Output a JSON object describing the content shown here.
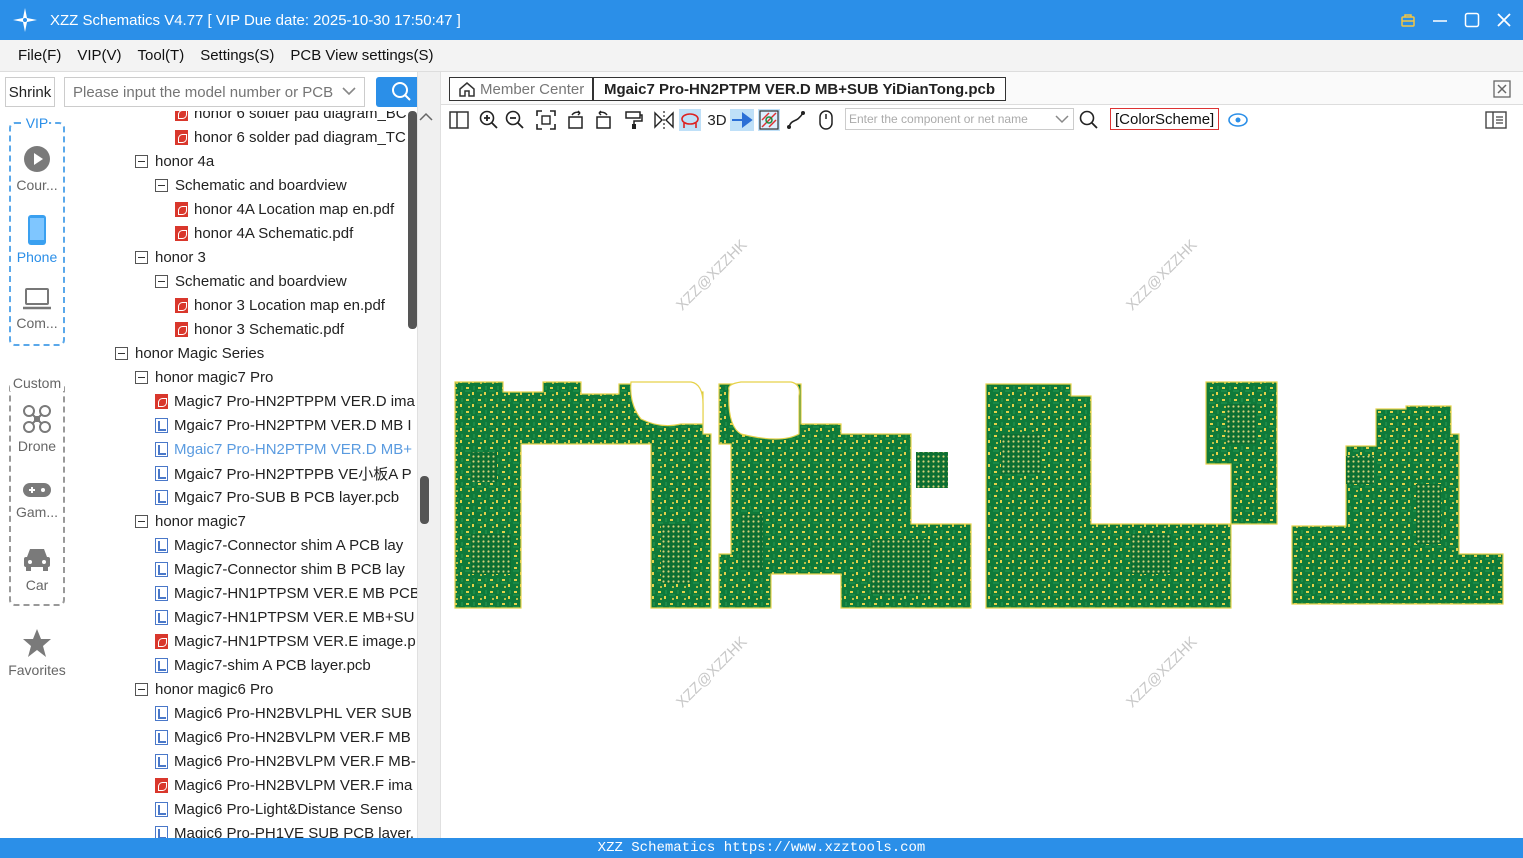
{
  "window": {
    "title": "XZZ Schematics V4.77 [ VIP Due date: 2025-10-30 17:50:47 ]"
  },
  "menu": [
    "File(F)",
    "VIP(V)",
    "Tool(T)",
    "Settings(S)",
    "PCB View settings(S)"
  ],
  "left": {
    "shrink_label": "Shrink",
    "search_placeholder": "Please input the model number or PCB",
    "vip_label": "VIP",
    "custom_label": "Custom",
    "vip_items": [
      {
        "label": "Cour...",
        "icon": "play-circle-icon"
      },
      {
        "label": "Phone",
        "icon": "phone-icon"
      },
      {
        "label": "Com...",
        "icon": "laptop-icon"
      }
    ],
    "custom_items": [
      {
        "label": "Drone",
        "icon": "drone-icon"
      },
      {
        "label": "Gam...",
        "icon": "gamepad-icon"
      },
      {
        "label": "Car",
        "icon": "car-icon"
      }
    ],
    "favorites_label": "Favorites"
  },
  "tree": [
    {
      "level": 3,
      "type": "pdf",
      "label": "honor 6 solder pad diagram_BC"
    },
    {
      "level": 3,
      "type": "pdf",
      "label": "honor 6 solder pad diagram_TC"
    },
    {
      "level": 1,
      "type": "folder",
      "label": "honor 4a"
    },
    {
      "level": 2,
      "type": "folder",
      "label": "Schematic and boardview"
    },
    {
      "level": 3,
      "type": "pdf",
      "label": "honor 4A Location map en.pdf"
    },
    {
      "level": 3,
      "type": "pdf",
      "label": "honor 4A Schematic.pdf"
    },
    {
      "level": 1,
      "type": "folder",
      "label": "honor 3"
    },
    {
      "level": 2,
      "type": "folder",
      "label": "Schematic and boardview"
    },
    {
      "level": 3,
      "type": "pdf",
      "label": "honor 3 Location map en.pdf"
    },
    {
      "level": 3,
      "type": "pdf",
      "label": "honor 3 Schematic.pdf"
    },
    {
      "level": 0,
      "type": "folder",
      "label": "honor Magic Series"
    },
    {
      "level": 1,
      "type": "folder",
      "label": "honor magic7 Pro"
    },
    {
      "level": 2,
      "type": "pdf",
      "label": "Magic7 Pro-HN2PTPPM VER.D ima"
    },
    {
      "level": 2,
      "type": "pcb",
      "label": "Mgaic7 Pro-HN2PTPM VER.D MB I"
    },
    {
      "level": 2,
      "type": "pcb",
      "label": "Mgaic7 Pro-HN2PTPM VER.D MB+",
      "selected": true
    },
    {
      "level": 2,
      "type": "pcb",
      "label": "Mgaic7 Pro-HN2PTPPB VE小板A P"
    },
    {
      "level": 2,
      "type": "pcb",
      "label": "Mgaic7 Pro-SUB B PCB layer.pcb"
    },
    {
      "level": 1,
      "type": "folder",
      "label": "honor magic7"
    },
    {
      "level": 2,
      "type": "pcb",
      "label": "Magic7-Connector shim A PCB lay"
    },
    {
      "level": 2,
      "type": "pcb",
      "label": "Magic7-Connector shim B PCB lay"
    },
    {
      "level": 2,
      "type": "pcb",
      "label": "Magic7-HN1PTPSM VER.E MB PCB"
    },
    {
      "level": 2,
      "type": "pcb",
      "label": "Magic7-HN1PTPSM VER.E MB+SU"
    },
    {
      "level": 2,
      "type": "pdf",
      "label": "Magic7-HN1PTPSM VER.E image.p"
    },
    {
      "level": 2,
      "type": "pcb",
      "label": "Magic7-shim A PCB layer.pcb"
    },
    {
      "level": 1,
      "type": "folder",
      "label": "honor magic6 Pro"
    },
    {
      "level": 2,
      "type": "pcb",
      "label": "Magic6 Pro-HN2BVLPHL VER SUB"
    },
    {
      "level": 2,
      "type": "pcb",
      "label": "Magic6 Pro-HN2BVLPM VER.F MB"
    },
    {
      "level": 2,
      "type": "pcb",
      "label": "Magic6 Pro-HN2BVLPM VER.F MB-"
    },
    {
      "level": 2,
      "type": "pdf",
      "label": "Magic6 Pro-HN2BVLPM VER.F ima"
    },
    {
      "level": 2,
      "type": "pcb",
      "label": "Magic6 Pro-Light&Distance Senso"
    },
    {
      "level": 2,
      "type": "pcb",
      "label": "Magic6 Pro-PH1VE SUB PCB layer."
    }
  ],
  "tabs": {
    "member": "Member Center",
    "file": "Mgaic7 Pro-HN2PTPM VER.D MB+SUB YiDianTong.pcb"
  },
  "toolbar": {
    "label_3d": "3D",
    "component_placeholder": "Enter the component or net name",
    "color_scheme": "[ColorScheme]"
  },
  "watermark": "XZZ@XZZHK",
  "status": "XZZ Schematics https://www.xzztools.com",
  "colors": {
    "accent": "#2b8fe8",
    "pcb_green": "#0f7a3a",
    "pad_yellow": "#e6d24a"
  }
}
